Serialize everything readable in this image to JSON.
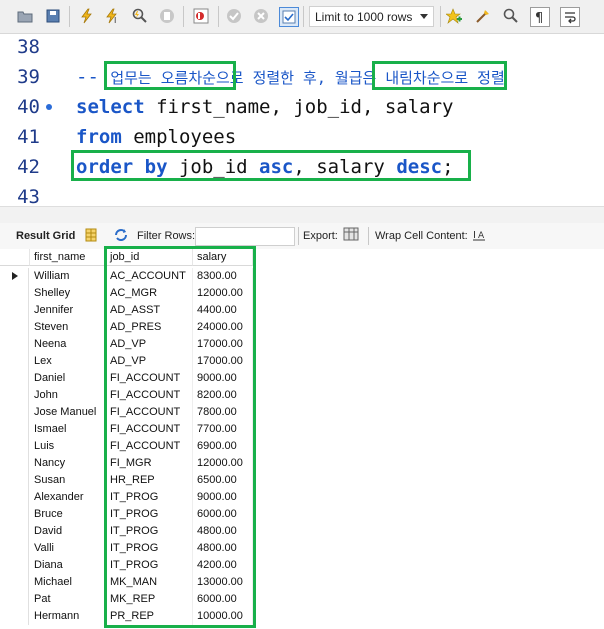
{
  "toolbar": {
    "limit_select": "Limit to 1000 rows",
    "icons": [
      "folder-open-icon",
      "save-icon",
      "execute-icon",
      "execute-current-icon",
      "explain-icon",
      "stop-icon",
      "toggle-error-icon",
      "commit-icon",
      "rollback-icon",
      "autocommit-icon",
      "beautify-icon",
      "find-icon",
      "invisible-chars-icon",
      "wrap-icon"
    ]
  },
  "editor": {
    "lines": [
      {
        "num": "38"
      },
      {
        "num": "39",
        "comment_prefix": "-- ",
        "comment_part1": "업무는 오름차순",
        "comment_part2": "으로 정렬한 후, ",
        "comment_part3": "월급은 내림차순",
        "comment_part4": "으로 정렬"
      },
      {
        "num": "40",
        "kw": "select",
        "text": " first_name, job_id, salary"
      },
      {
        "num": "41",
        "kw": "from",
        "text": " employees"
      },
      {
        "num": "42",
        "kw1": "order by",
        "t1": " job_id ",
        "kw2": "asc",
        "t2": ", salary ",
        "kw3": "desc",
        "t3": ";"
      },
      {
        "num": "43"
      }
    ],
    "highlight_color": "#18b04a"
  },
  "result_toolbar": {
    "result_grid": "Result Grid",
    "filter_rows": "Filter Rows:",
    "export": "Export:",
    "wrap_cell": "Wrap Cell Content:"
  },
  "grid": {
    "columns": [
      "first_name",
      "job_id",
      "salary"
    ],
    "rows": [
      [
        "William",
        "AC_ACCOUNT",
        "8300.00"
      ],
      [
        "Shelley",
        "AC_MGR",
        "12000.00"
      ],
      [
        "Jennifer",
        "AD_ASST",
        "4400.00"
      ],
      [
        "Steven",
        "AD_PRES",
        "24000.00"
      ],
      [
        "Neena",
        "AD_VP",
        "17000.00"
      ],
      [
        "Lex",
        "AD_VP",
        "17000.00"
      ],
      [
        "Daniel",
        "FI_ACCOUNT",
        "9000.00"
      ],
      [
        "John",
        "FI_ACCOUNT",
        "8200.00"
      ],
      [
        "Jose Manuel",
        "FI_ACCOUNT",
        "7800.00"
      ],
      [
        "Ismael",
        "FI_ACCOUNT",
        "7700.00"
      ],
      [
        "Luis",
        "FI_ACCOUNT",
        "6900.00"
      ],
      [
        "Nancy",
        "FI_MGR",
        "12000.00"
      ],
      [
        "Susan",
        "HR_REP",
        "6500.00"
      ],
      [
        "Alexander",
        "IT_PROG",
        "9000.00"
      ],
      [
        "Bruce",
        "IT_PROG",
        "6000.00"
      ],
      [
        "David",
        "IT_PROG",
        "4800.00"
      ],
      [
        "Valli",
        "IT_PROG",
        "4800.00"
      ],
      [
        "Diana",
        "IT_PROG",
        "4200.00"
      ],
      [
        "Michael",
        "MK_MAN",
        "13000.00"
      ],
      [
        "Pat",
        "MK_REP",
        "6000.00"
      ],
      [
        "Hermann",
        "PR_REP",
        "10000.00"
      ]
    ]
  }
}
